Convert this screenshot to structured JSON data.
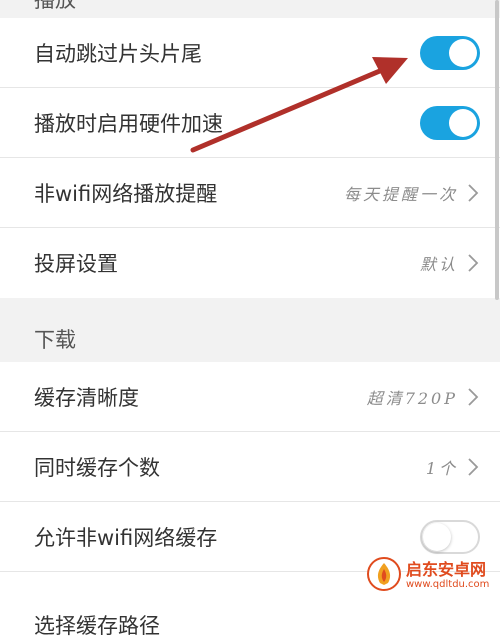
{
  "sections": {
    "playback": {
      "header": "播放",
      "auto_skip": {
        "label": "自动跳过片头片尾",
        "state": "on"
      },
      "hw_accel": {
        "label": "播放时启用硬件加速",
        "state": "on"
      },
      "non_wifi_reminder": {
        "label": "非wifi网络播放提醒",
        "value": "每天提醒一次"
      },
      "cast_settings": {
        "label": "投屏设置",
        "value": "默认"
      }
    },
    "download": {
      "header": "下载",
      "cache_quality": {
        "label": "缓存清晰度",
        "value": "超清720P"
      },
      "simultaneous": {
        "label": "同时缓存个数",
        "value": "1个"
      },
      "allow_non_wifi": {
        "label": "允许非wifi网络缓存",
        "state": "off"
      },
      "cache_path": {
        "label": "选择缓存路径"
      }
    }
  },
  "colors": {
    "toggle_on": "#1aa3e0",
    "arrow": "#b0302a",
    "background": "#f2f2f2"
  },
  "watermark": {
    "title": "启东安卓网",
    "url": "www.qdltdu.com"
  }
}
